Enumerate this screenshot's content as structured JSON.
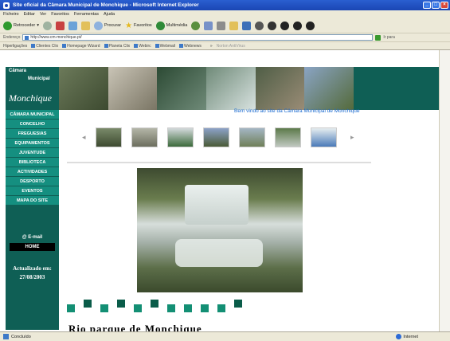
{
  "window": {
    "title": "Site oficial da Câmara Municipal de Monchique - Microsoft Internet Explorer"
  },
  "menu": [
    "Ficheiro",
    "Editar",
    "Ver",
    "Favoritos",
    "Ferramentas",
    "Ajuda"
  ],
  "toolbar": {
    "back": "Retroceder",
    "search": "Procurar",
    "favorites": "Favoritos",
    "media": "Multimédia"
  },
  "address": {
    "label": "Endereço",
    "url": "http://www.cm-monchique.pt/",
    "go": "Ir para"
  },
  "links": {
    "label": "Hiperligações",
    "items": [
      "Clientes Clix",
      "Homepage Wizard",
      "Planeta Clix",
      "Webirc",
      "Webmail",
      "Webnews"
    ],
    "norton": "Norton AntiVirus"
  },
  "site": {
    "logo": {
      "l1": "Câmara",
      "l2": "Municipal",
      "l3": "Monchique"
    },
    "welcome": "Bem vindo ao site da Câmara Municipal de Monchique",
    "nav": [
      "CÂMARA MUNICIPAL",
      "CONCELHO",
      "FREGUESIAS",
      "EQUIPAMENTOS",
      "JUVENTUDE",
      "BIBLIOTECA",
      "ACTIVIDADES",
      "DESPORTO",
      "EVENTOS",
      "MAPA DO SITE"
    ],
    "email": "@ E-mail",
    "home": "HOME",
    "updated_label": "Actualizado em:",
    "updated_date": "27/08/2003",
    "title": "Rio parque de Monchique"
  },
  "status": {
    "text": "Concluído",
    "zone": "Internet"
  }
}
